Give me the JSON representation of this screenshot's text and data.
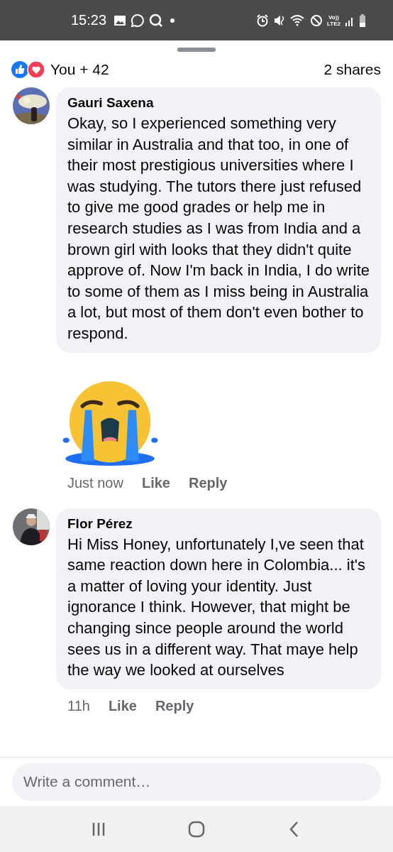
{
  "status_bar": {
    "time": "15:23",
    "network_label_top": "Vo))",
    "network_label_bottom": "LTE2"
  },
  "reactions": {
    "summary": "You + 42",
    "shares": "2 shares"
  },
  "comments": [
    {
      "author": "Gauri Saxena",
      "text": "Okay, so I experienced something very similar in Australia and that too, in one of their most prestigious universities where I was studying. The tutors there just refused to give me good grades or help me in research studies as I was from India and a brown girl with looks that they didn't quite approve of. Now I'm back in India, I do write to some of them as I miss being in Australia a lot, but most of them don't even bother to respond.",
      "sticker": true,
      "time": "Just now",
      "actions": [
        "Like",
        "Reply"
      ]
    },
    {
      "author": "Flor Pérez",
      "text": "Hi Miss Honey, unfortunately I,ve seen that same reaction down here in Colombia... it's a matter of loving your identity. Just ignorance I think. However, that might be changing since  people around the world sees us in a different way. That maye help the way we looked at ourselves",
      "sticker": false,
      "time": "11h",
      "actions": [
        "Like",
        "Reply"
      ]
    }
  ],
  "composer": {
    "placeholder": "Write a comment…"
  }
}
